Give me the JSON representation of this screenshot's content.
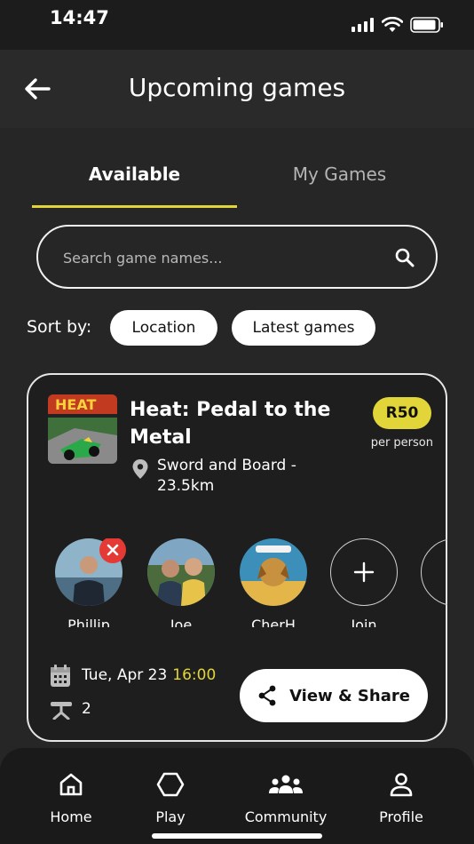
{
  "status_bar": {
    "time": "14:47"
  },
  "header": {
    "title": "Upcoming games"
  },
  "tabs": [
    {
      "label": "Available",
      "active": true
    },
    {
      "label": "My Games",
      "active": false
    }
  ],
  "search": {
    "placeholder": "Search game names...",
    "value": ""
  },
  "sort": {
    "label": "Sort by:",
    "options": [
      "Location",
      "Latest games"
    ]
  },
  "game_card": {
    "title": "Heat: Pedal to the Metal",
    "location": "Sword and Board - 23.5km",
    "price": "R50",
    "price_note": "per person",
    "thumbnail_text": "HEAT",
    "players": [
      {
        "name": "Phillip",
        "removable": true
      },
      {
        "name": "Joe",
        "removable": false
      },
      {
        "name": "CherH",
        "removable": false
      }
    ],
    "join_label": "Join",
    "date": "Tue, Apr 23",
    "time": "16:00",
    "tables": "2",
    "share_label": "View & Share"
  },
  "bottom_nav": [
    {
      "label": "Home",
      "icon": "home-icon"
    },
    {
      "label": "Play",
      "icon": "hexagon-icon"
    },
    {
      "label": "Community",
      "icon": "community-icon"
    },
    {
      "label": "Profile",
      "icon": "profile-icon"
    }
  ],
  "colors": {
    "accent": "#e2d53a",
    "background": "#262626",
    "remove": "#e53935"
  }
}
